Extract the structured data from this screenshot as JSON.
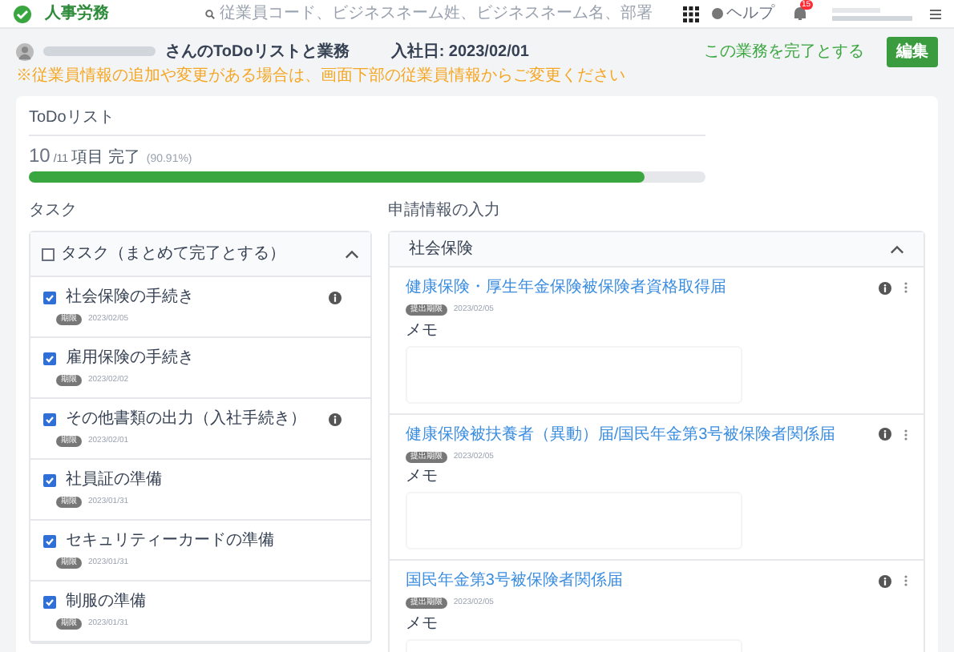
{
  "header": {
    "logo_text": "人事労務",
    "search": {
      "placeholder": "従業員コード、ビジネスネーム姓、ビジネスネーム名、部署"
    },
    "help": "ヘルプ",
    "notification_count": "15"
  },
  "employee": {
    "title_suffix": "さんのToDoリストと業務",
    "hire_date": "入社日: 2023/02/01",
    "complete_link": "この業務を完了とする",
    "edit_button": "編集",
    "notice": "※従業員情報の追加や変更がある場合は、画面下部の従業員情報からご変更ください"
  },
  "todo": {
    "title": "ToDoリスト",
    "done": "10",
    "total": "/11",
    "label": "項目 完了",
    "percent": "(90.91%)",
    "level": 0.909
  },
  "tasks": {
    "heading": "タスク",
    "group": {
      "label": "タスク（まとめて完了とする）",
      "checked": false,
      "expanded": true
    },
    "items": [
      {
        "label": "社会保険の手続き",
        "checked": true,
        "info": true,
        "badge": "期限",
        "date": "2023/02/05"
      },
      {
        "label": "雇用保険の手続き",
        "checked": true,
        "info": false,
        "badge": "期限",
        "date": "2023/02/02"
      },
      {
        "label": "その他書類の出力（入社手続き）",
        "checked": true,
        "info": true,
        "badge": "期限",
        "date": "2023/02/01"
      },
      {
        "label": "社員証の準備",
        "checked": true,
        "info": false,
        "badge": "期限",
        "date": "2023/01/31"
      },
      {
        "label": "セキュリティーカードの準備",
        "checked": true,
        "info": false,
        "badge": "期限",
        "date": "2023/01/31"
      },
      {
        "label": "制服の準備",
        "checked": true,
        "info": false,
        "badge": "期限",
        "date": "2023/01/31"
      }
    ]
  },
  "applications": {
    "heading": "申請情報の入力",
    "group": {
      "label": "社会保険",
      "expanded": true
    },
    "forms": [
      {
        "title": "健康保険・厚生年金保険被保険者資格取得届",
        "badge": "提出期限",
        "date": "2023/02/05",
        "memo_label": "メモ"
      },
      {
        "title": "健康保険被扶養者（異動）届/国民年金第3号被保険者関係届",
        "badge": "提出期限",
        "date": "2023/02/05",
        "memo_label": "メモ"
      },
      {
        "title": "国民年金第3号被保険者関係届",
        "badge": "提出期限",
        "date": "2023/02/05",
        "memo_label": "メモ"
      }
    ]
  }
}
